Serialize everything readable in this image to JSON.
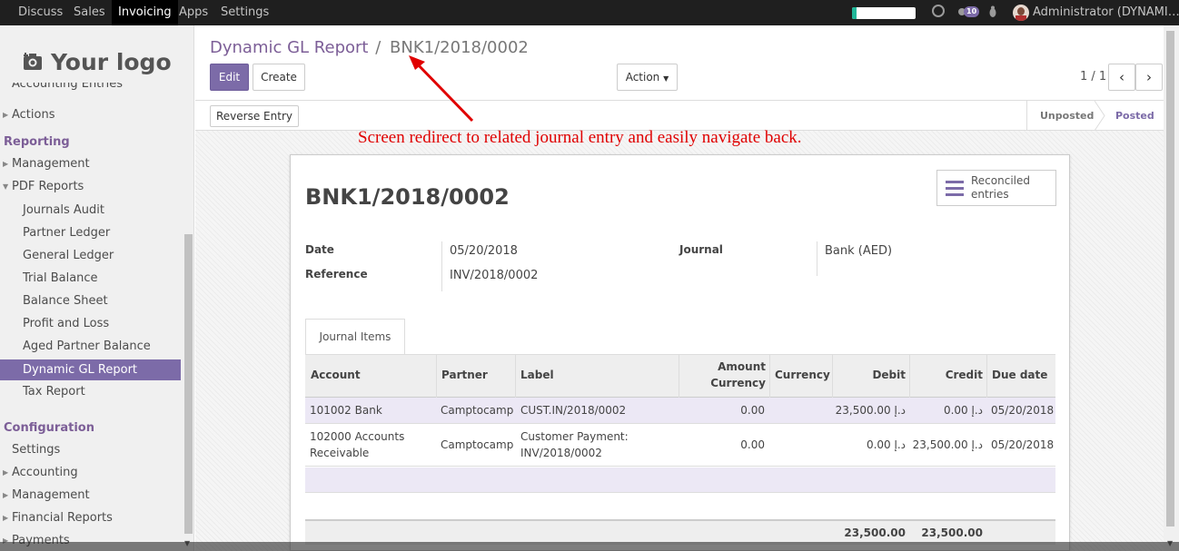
{
  "topbar": {
    "menu": [
      "Discuss",
      "Sales",
      "Invoicing",
      "Apps",
      "Settings"
    ],
    "active": "Invoicing",
    "chat_count": "10",
    "user": "Administrator (DYNAMI…"
  },
  "sidebar": {
    "logo_text": "Your logo",
    "cut_item": "Accounting Entries",
    "items": {
      "actions": "Actions",
      "reporting": "Reporting",
      "management": "Management",
      "pdf_reports": "PDF Reports",
      "journals_audit": "Journals Audit",
      "partner_ledger": "Partner Ledger",
      "general_ledger": "General Ledger",
      "trial_balance": "Trial Balance",
      "balance_sheet": "Balance Sheet",
      "profit_loss": "Profit and Loss",
      "aged_partner": "Aged Partner Balance",
      "dynamic_gl": "Dynamic GL Report",
      "tax_report": "Tax Report",
      "configuration": "Configuration",
      "settings": "Settings",
      "accounting": "Accounting",
      "management2": "Management",
      "financial_reports": "Financial Reports",
      "payments": "Payments"
    }
  },
  "breadcrumb": {
    "parent": "Dynamic GL Report",
    "sep": "/",
    "current": "BNK1/2018/0002"
  },
  "buttons": {
    "edit": "Edit",
    "create": "Create",
    "action": "Action",
    "reverse": "Reverse Entry"
  },
  "pager": {
    "text": "1 / 1"
  },
  "status": {
    "unposted": "Unposted",
    "posted": "Posted"
  },
  "annotation": "Screen redirect to related journal entry and easily navigate back.",
  "entry": {
    "name": "BNK1/2018/0002",
    "reconciled_label": "Reconciled",
    "reconciled_label2": "entries",
    "date_label": "Date",
    "date": "05/20/2018",
    "reference_label": "Reference",
    "reference": "INV/2018/0002",
    "journal_label": "Journal",
    "journal": "Bank (AED)"
  },
  "tab": "Journal Items",
  "table": {
    "headers": {
      "account": "Account",
      "partner": "Partner",
      "label": "Label",
      "amount_currency_1": "Amount",
      "amount_currency_2": "Currency",
      "currency": "Currency",
      "debit": "Debit",
      "credit": "Credit",
      "due_date": "Due date"
    },
    "rows": [
      {
        "account": "101002 Bank",
        "account2": "",
        "partner": "Camptocamp",
        "label": "CUST.IN/2018/0002",
        "label2": "",
        "amount_currency": "0.00",
        "currency": "",
        "debit": "23,500.00 د.إ",
        "credit": "0.00 د.إ",
        "due_date": "05/20/2018"
      },
      {
        "account": "102000 Accounts",
        "account2": "Receivable",
        "partner": "Camptocamp",
        "label": "Customer Payment:",
        "label2": "INV/2018/0002",
        "amount_currency": "0.00",
        "currency": "",
        "debit": "0.00 د.إ",
        "credit": "23,500.00 د.إ",
        "due_date": "05/20/2018"
      }
    ],
    "total_debit": "23,500.00",
    "total_credit": "23,500.00"
  },
  "colors": {
    "primary": "#7c6ba8",
    "annotation": "#e00000",
    "topbar": "#1f1f1f"
  }
}
